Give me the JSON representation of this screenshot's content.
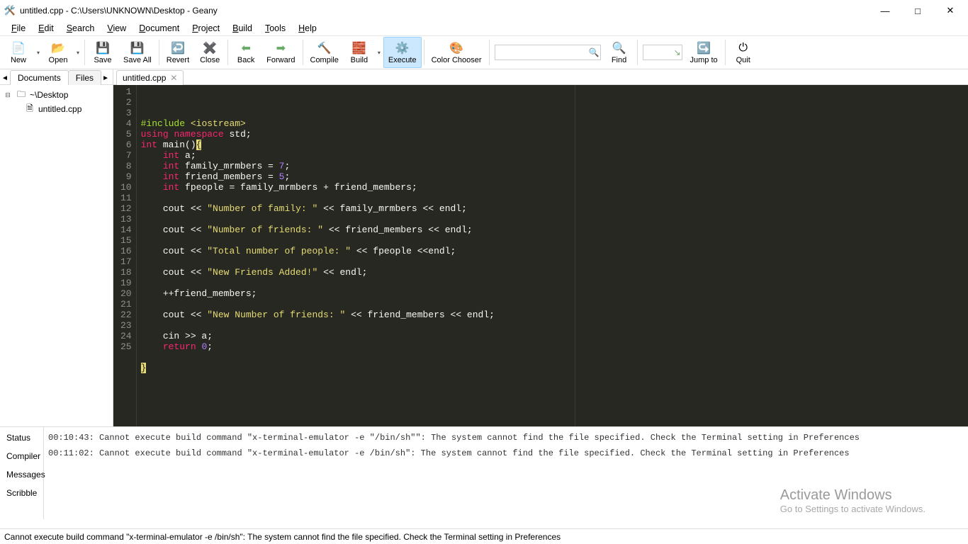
{
  "window": {
    "title": "untitled.cpp - C:\\Users\\UNKNOWN\\Desktop - Geany"
  },
  "menu": [
    "File",
    "Edit",
    "Search",
    "View",
    "Document",
    "Project",
    "Build",
    "Tools",
    "Help"
  ],
  "toolbar": {
    "new": "New",
    "open": "Open",
    "save": "Save",
    "saveall": "Save All",
    "revert": "Revert",
    "close": "Close",
    "back": "Back",
    "forward": "Forward",
    "compile": "Compile",
    "build": "Build",
    "execute": "Execute",
    "color": "Color Chooser",
    "find": "Find",
    "jump": "Jump to",
    "quit": "Quit"
  },
  "side": {
    "tabs": {
      "documents": "Documents",
      "files": "Files"
    },
    "tree": {
      "root": "~\\Desktop",
      "file": "untitled.cpp"
    }
  },
  "editor": {
    "tab": "untitled.cpp",
    "lines": [
      "#include <iostream>",
      "using namespace std;",
      "int main(){",
      "    int a;",
      "    int family_mrmbers = 7;",
      "    int friend_members = 5;",
      "    int fpeople = family_mrmbers + friend_members;",
      "",
      "    cout << \"Number of family: \" << family_mrmbers << endl;",
      "",
      "    cout << \"Number of friends: \" << friend_members << endl;",
      "",
      "    cout << \"Total number of people: \" << fpeople <<endl;",
      "",
      "    cout << \"New Friends Added!\" << endl;",
      "",
      "    ++friend_members;",
      "",
      "    cout << \"New Number of friends: \" << friend_members << endl;",
      "",
      "    cin >> a;",
      "    return 0;",
      "",
      "}",
      ""
    ]
  },
  "bottom_tabs": {
    "status": "Status",
    "compiler": "Compiler",
    "messages": "Messages",
    "scribble": "Scribble"
  },
  "messages": [
    "00:10:43: Cannot execute build command \"x-terminal-emulator -e \"/bin/sh\"\": The system cannot find the file specified. Check the Terminal setting in Preferences",
    "00:11:02: Cannot execute build command \"x-terminal-emulator -e  /bin/sh\": The system cannot find the file specified. Check the Terminal setting in Preferences"
  ],
  "statusbar": "Cannot execute build command \"x-terminal-emulator -e  /bin/sh\": The system cannot find the file specified. Check the Terminal setting in Preferences",
  "watermark": {
    "l1": "Activate Windows",
    "l2": "Go to Settings to activate Windows."
  }
}
